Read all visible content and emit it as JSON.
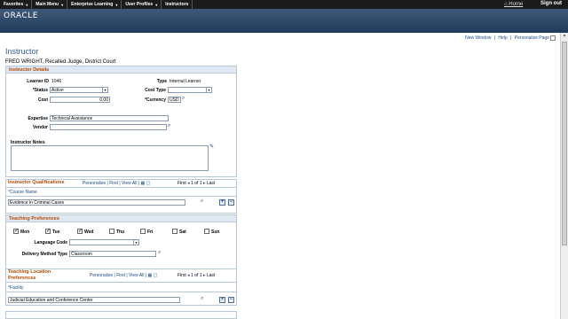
{
  "topnav": {
    "items": [
      "Favorites",
      "Main Menu",
      "Enterprise Learning",
      "User Profiles",
      "Instructors"
    ],
    "home": "Home",
    "signout": "Sign out"
  },
  "banner": {
    "logo": "ORACLE"
  },
  "toplinks": {
    "new_window": "New Window",
    "help": "Help",
    "personalize_page": "Personalize Page",
    "sep": "|"
  },
  "page": {
    "title": "Instructor",
    "subtitle": "FRED WRIGHT, Recalled Judge, District Court"
  },
  "details": {
    "header": "Instructor Details",
    "learner_id_label": "Learner ID",
    "learner_id": "1046",
    "type_label": "Type",
    "type_value": "Internal Learner",
    "status_label": "*Status",
    "status_value": "Active",
    "cost_type_label": "Cost Type",
    "cost_type_value": "",
    "cost_label": "Cost",
    "cost_value": "0.00",
    "currency_label": "*Currency",
    "currency_value": "USD",
    "expertise_label": "Expertise",
    "expertise_value": "Technical Assistance",
    "vendor_label": "Vendor",
    "vendor_value": "",
    "notes_label": "Instructor Notes"
  },
  "qualifications": {
    "header": "Instructor Qualifications",
    "personalize": "Personalize",
    "find": "Find",
    "view_all": "View All",
    "first": "First",
    "pager": "1 of 1",
    "last": "Last",
    "col": "*Course Name",
    "rows": [
      "Evidence in Criminal Cases"
    ]
  },
  "preferences": {
    "header": "Teaching Preferences",
    "days": [
      {
        "label": "Mon",
        "checked": true
      },
      {
        "label": "Tue",
        "checked": true
      },
      {
        "label": "Wed",
        "checked": true
      },
      {
        "label": "Thu",
        "checked": false
      },
      {
        "label": "Fri",
        "checked": false
      },
      {
        "label": "Sat",
        "checked": false
      },
      {
        "label": "Sun",
        "checked": false
      }
    ],
    "language_label": "Language Code",
    "language_value": "",
    "delivery_label": "Delivery Method Type",
    "delivery_value": "Classroom"
  },
  "location": {
    "header_line1": "Teaching Location",
    "header_line2": "Preferences",
    "personalize": "Personalize",
    "find": "Find",
    "view_all": "View All",
    "first": "First",
    "pager": "1 of 1",
    "last": "Last",
    "col": "*Facility",
    "rows": [
      "Judicial Education and Conference Center"
    ]
  }
}
